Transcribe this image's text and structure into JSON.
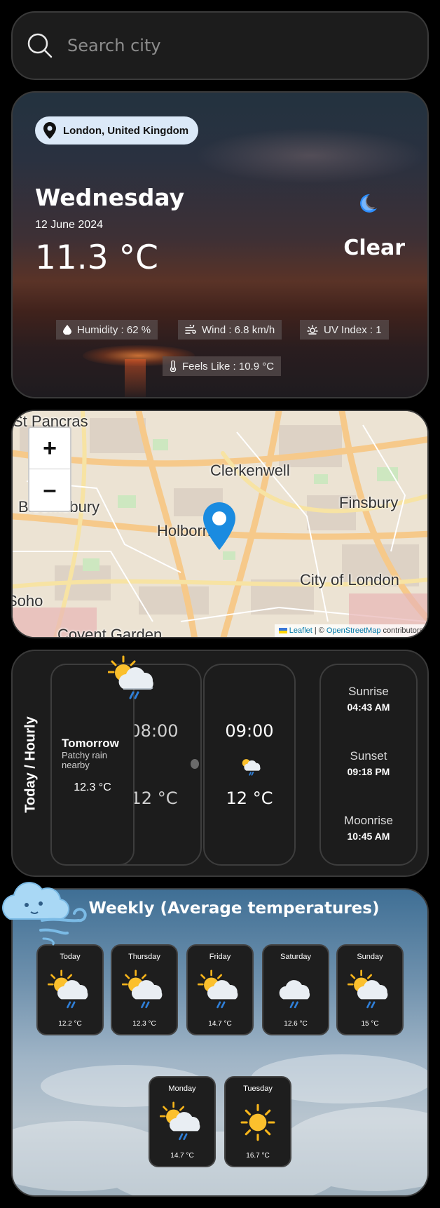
{
  "search": {
    "placeholder": "Search city"
  },
  "current": {
    "location": "London, United Kingdom",
    "day": "Wednesday",
    "date": "12 June 2024",
    "temperature": "11.3 °C",
    "condition": "Clear",
    "humidity": "Humidity : 62 %",
    "wind": "Wind : 6.8 km/h",
    "uv": "UV Index : 1",
    "feels_like": "Feels Like : 10.9 °C"
  },
  "map": {
    "zoom_in": "+",
    "zoom_out": "–",
    "labels": [
      "Clerkenwell",
      "Finsbury",
      "Bloomsbury",
      "Holborn",
      "City of London",
      "Covent Garden",
      "St Pancras",
      "Soho"
    ],
    "attribution": {
      "leaflet": "Leaflet",
      "separator": "| ©",
      "osm": "OpenStreetMap",
      "suffix": "contributors"
    }
  },
  "hourly": {
    "section_title": "Today / Hourly",
    "tomorrow": {
      "title": "Tomorrow",
      "condition": "Patchy rain nearby",
      "temp": "12.3 °C"
    },
    "partial": {
      "time": "08:00",
      "temp": "12 °C"
    },
    "items": [
      {
        "time": "09:00",
        "temp": "12 °C"
      }
    ],
    "astro": [
      {
        "label": "Sunrise",
        "value": "04:43 AM"
      },
      {
        "label": "Sunset",
        "value": "09:18 PM"
      },
      {
        "label": "Moonrise",
        "value": "10:45 AM"
      }
    ]
  },
  "weekly": {
    "title": "Weekly (Average temperatures)",
    "days": [
      {
        "name": "Today",
        "temp": "12.2 °C",
        "icon": "sun-cloud-rain-icon"
      },
      {
        "name": "Thursday",
        "temp": "12.3 °C",
        "icon": "sun-cloud-rain-icon"
      },
      {
        "name": "Friday",
        "temp": "14.7 °C",
        "icon": "sun-cloud-rain-icon"
      },
      {
        "name": "Saturday",
        "temp": "12.6 °C",
        "icon": "cloud-rain-icon"
      },
      {
        "name": "Sunday",
        "temp": "15 °C",
        "icon": "sun-cloud-rain-icon"
      },
      {
        "name": "Monday",
        "temp": "14.7 °C",
        "icon": "sun-cloud-rain-icon"
      },
      {
        "name": "Tuesday",
        "temp": "16.7 °C",
        "icon": "sun-icon"
      }
    ]
  },
  "colors": {
    "pill": "#dbe9f8",
    "map_marker": "#1a8be0",
    "card_bg": "#1c1c1c",
    "moon": "#2f8fff"
  }
}
